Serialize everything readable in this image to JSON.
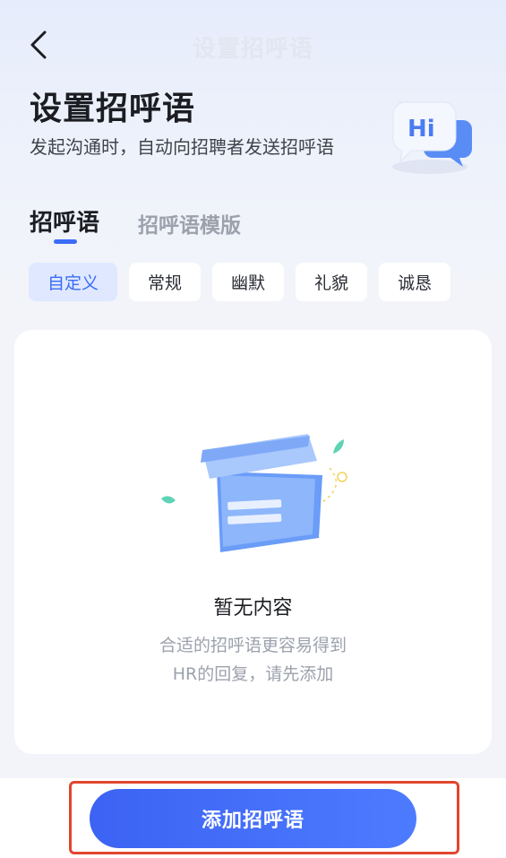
{
  "nav": {
    "title": "设置招呼语"
  },
  "hero": {
    "title": "设置招呼语",
    "subtitle": "发起沟通时，自动向招聘者发送招呼语",
    "badge_text": "Hi"
  },
  "tabs": [
    {
      "label": "招呼语",
      "active": true
    },
    {
      "label": "招呼语模版",
      "active": false
    }
  ],
  "chips": [
    {
      "label": "自定义",
      "active": true
    },
    {
      "label": "常规",
      "active": false
    },
    {
      "label": "幽默",
      "active": false
    },
    {
      "label": "礼貌",
      "active": false
    },
    {
      "label": "诚恳",
      "active": false
    }
  ],
  "empty_state": {
    "title": "暂无内容",
    "desc_line1": "合适的招呼语更容易得到",
    "desc_line2": "HR的回复，请先添加"
  },
  "footer": {
    "add_label": "添加招呼语"
  },
  "colors": {
    "accent": "#3b6cf6",
    "highlight_frame": "#e2452f",
    "chip_active_bg": "#dfe8ff"
  }
}
